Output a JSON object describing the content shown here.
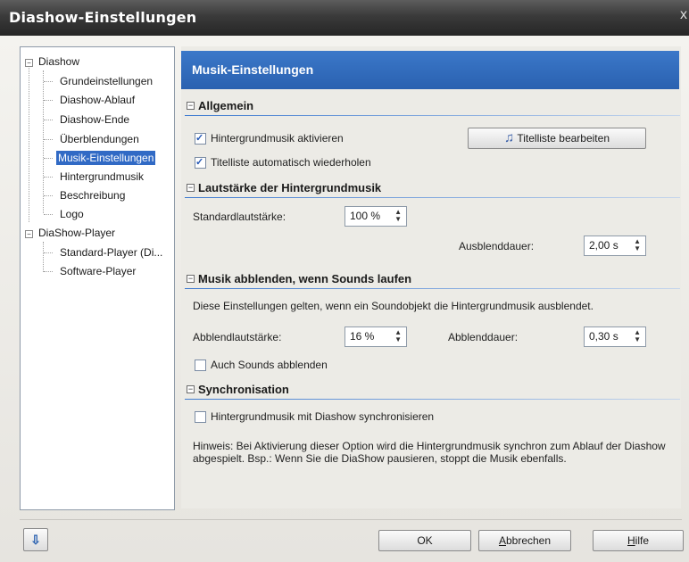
{
  "window": {
    "title": "Diashow-Einstellungen",
    "close": "x"
  },
  "tree": {
    "items": [
      {
        "label": "Diashow"
      },
      {
        "label": "Grundeinstellungen"
      },
      {
        "label": "Diashow-Ablauf"
      },
      {
        "label": "Diashow-Ende"
      },
      {
        "label": "Überblendungen"
      },
      {
        "label": "Musik-Einstellungen"
      },
      {
        "label": "Hintergrundmusik"
      },
      {
        "label": "Beschreibung"
      },
      {
        "label": "Logo"
      },
      {
        "label": "DiaShow-Player"
      },
      {
        "label": "Standard-Player (Di..."
      },
      {
        "label": "Software-Player"
      }
    ]
  },
  "panel": {
    "header": "Musik-Einstellungen",
    "sections": {
      "allgemein": "Allgemein",
      "lautstaerke": "Lautstärke der Hintergrundmusik",
      "abblenden": "Musik abblenden, wenn Sounds laufen",
      "sync": "Synchronisation"
    },
    "allgemein": {
      "cb_bgmusic": "Hintergrundmusik aktivieren",
      "cb_repeat": "Titelliste automatisch wiederholen",
      "btn_playlist": "Titelliste bearbeiten"
    },
    "lautstaerke": {
      "std_label": "Standardlautstärke:",
      "std_value": "100 %",
      "fade_label": "Ausblenddauer:",
      "fade_value": "2,00 s"
    },
    "abblenden": {
      "info": "Diese Einstellungen gelten, wenn ein Soundobjekt die Hintergrundmusik ausblendet.",
      "vol_label": "Abblendlautstärke:",
      "vol_value": "16 %",
      "dur_label": "Abblenddauer:",
      "dur_value": "0,30 s",
      "cb_sounds": "Auch Sounds abblenden"
    },
    "sync": {
      "cb_sync": "Hintergrundmusik mit Diashow synchronisieren",
      "hint": "Hinweis: Bei Aktivierung dieser Option wird die Hintergrundmusik synchron zum Ablauf der Diashow abgespielt. Bsp.: Wenn Sie die DiaShow pausieren, stoppt die Musik ebenfalls."
    }
  },
  "buttons": {
    "ok": "OK",
    "cancel_prefix": "A",
    "cancel_rest": "bbrechen",
    "help_prefix": "H",
    "help_rest": "ilfe"
  },
  "colors": {
    "accent": "#316ac5",
    "header": "#2f6bbd"
  }
}
